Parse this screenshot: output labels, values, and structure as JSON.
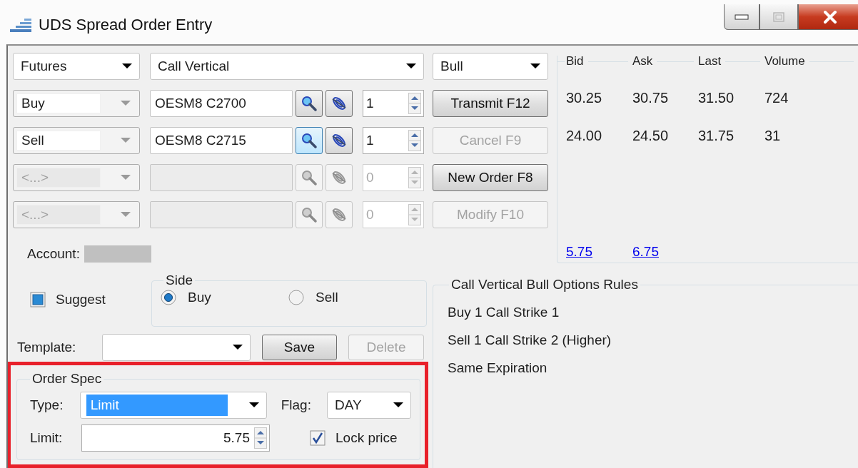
{
  "window": {
    "title": "UDS Spread Order Entry"
  },
  "instrument_type": {
    "value": "Futures"
  },
  "strategy": {
    "value": "Call Vertical"
  },
  "direction": {
    "value": "Bull"
  },
  "legs": [
    {
      "side": "Buy",
      "symbol": "OESM8 C2700",
      "quantity": "1",
      "disabled": false,
      "search_focused": false
    },
    {
      "side": "Sell",
      "symbol": "OESM8 C2715",
      "quantity": "1",
      "disabled": false,
      "search_focused": true
    },
    {
      "side": "<...>",
      "quantity": "0",
      "disabled": true,
      "search_focused": false
    },
    {
      "side": "<...>",
      "quantity": "0",
      "disabled": true,
      "search_focused": false
    }
  ],
  "actions": [
    {
      "label": "Transmit F12",
      "disabled": false
    },
    {
      "label": "Cancel F9",
      "disabled": true
    },
    {
      "label": "New Order F8",
      "disabled": false
    },
    {
      "label": "Modify F10",
      "disabled": true
    }
  ],
  "quotes": {
    "columns": [
      "Bid",
      "Ask",
      "Last",
      "Volume"
    ],
    "rows": [
      [
        "30.25",
        "30.75",
        "31.50",
        "724"
      ],
      [
        "24.00",
        "24.50",
        "31.75",
        "31"
      ]
    ],
    "links": [
      "5.75",
      "6.75"
    ]
  },
  "account": {
    "label": "Account:"
  },
  "suggest": {
    "label": "Suggest",
    "indeterminate": true
  },
  "side": {
    "title": "Side",
    "options": [
      {
        "label": "Buy",
        "selected": true
      },
      {
        "label": "Sell",
        "selected": false
      }
    ]
  },
  "template": {
    "label": "Template:",
    "buttons": [
      {
        "label": "Save",
        "disabled": false
      },
      {
        "label": "Delete",
        "disabled": true
      }
    ]
  },
  "order_spec": {
    "highlighted": true,
    "title": "Order Spec",
    "type": {
      "label": "Type:",
      "value": "Limit",
      "text_selected": true
    },
    "flag": {
      "label": "Flag:",
      "value": "DAY"
    },
    "limit": {
      "label": "Limit:",
      "value": "5.75"
    },
    "lock_price": {
      "label": "Lock price",
      "checked": true
    }
  },
  "rules": {
    "title": "Call Vertical Bull Options Rules",
    "lines": [
      "Buy 1 Call Strike 1",
      "Sell 1 Call Strike 2 (Higher)",
      "Same Expiration"
    ]
  }
}
